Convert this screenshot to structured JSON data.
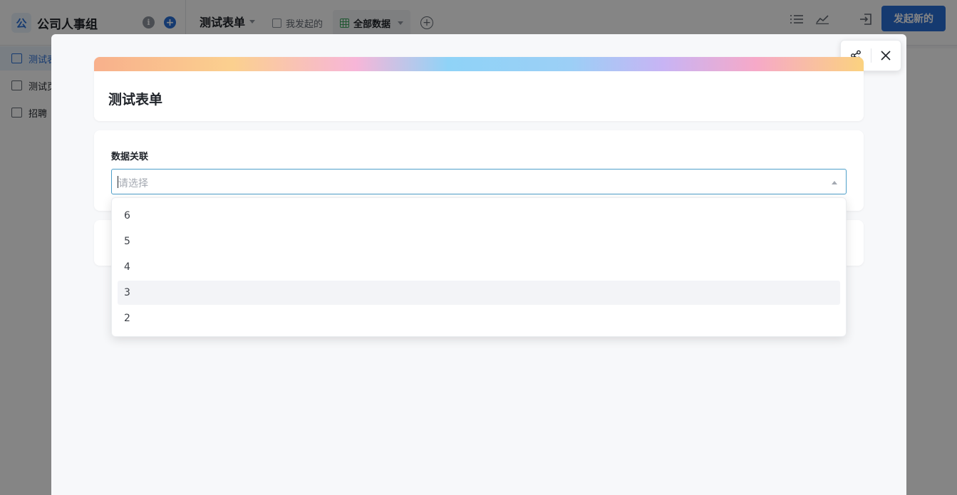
{
  "app": {
    "logo_char": "公",
    "name": "公司人事组"
  },
  "header": {
    "form_name": "测试表单",
    "tabs": [
      {
        "label": "我发起的"
      },
      {
        "label": "全部数据"
      }
    ],
    "launch_button": "发起新的"
  },
  "sidebar": {
    "items": [
      {
        "label": "测试表"
      },
      {
        "label": "测试页"
      },
      {
        "label": "招聘"
      }
    ]
  },
  "modal": {
    "form_title": "测试表单",
    "field": {
      "label": "数据关联",
      "placeholder": "请选择",
      "options": [
        "6",
        "5",
        "4",
        "3",
        "2"
      ],
      "hovered_option": "3"
    }
  },
  "colors": {
    "accent": "#2a6fd6",
    "focus_border": "#4e9fc9"
  }
}
